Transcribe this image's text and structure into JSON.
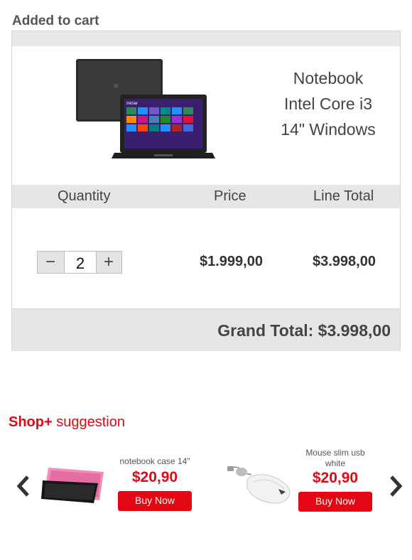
{
  "page": {
    "title": "Added to cart"
  },
  "product": {
    "name_line1": "Notebook",
    "name_line2": "Intel Core i3",
    "name_line3": "14\" Windows",
    "screen_label": "Iniciar"
  },
  "cart": {
    "headers": {
      "quantity": "Quantity",
      "price": "Price",
      "line_total": "Line Total"
    },
    "quantity": "2",
    "minus_label": "−",
    "plus_label": "+",
    "price": "$1.999,00",
    "line_total": "$3.998,00",
    "grand_total": "Grand Total: $3.998,00"
  },
  "suggestions": {
    "title_brand": "Shop+",
    "title_rest": " suggestion",
    "items": [
      {
        "name": "notebook case 14\"",
        "price": "$20,90",
        "button": "Buy Now"
      },
      {
        "name": "Mouse slim usb white",
        "price": "$20,90",
        "button": "Buy Now"
      }
    ]
  },
  "colors": {
    "accent": "#e30613",
    "header_bg": "#e6e6e6",
    "border": "#d6d6d6"
  },
  "icons": {
    "prev": "chevron-left-icon",
    "next": "chevron-right-icon"
  }
}
